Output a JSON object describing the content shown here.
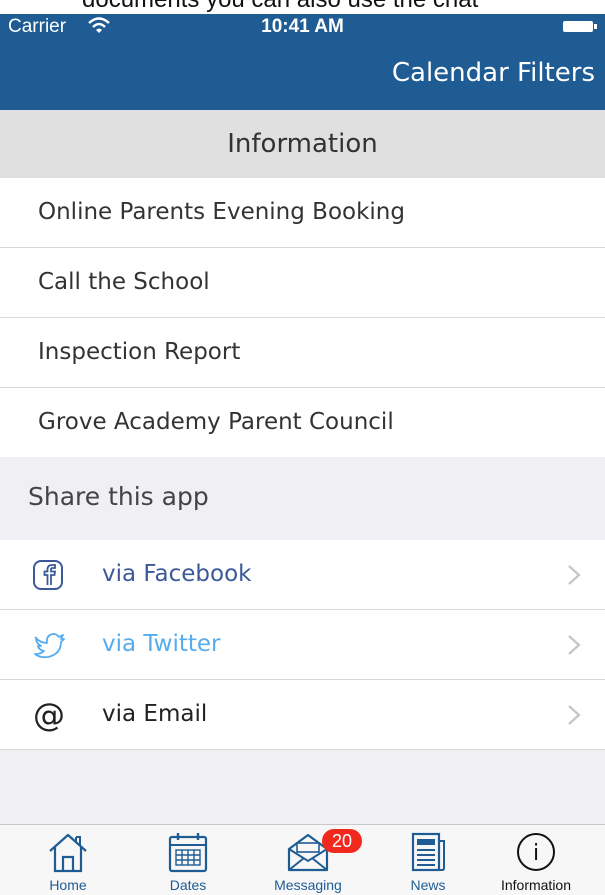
{
  "background_text": "documents you can also use the chat",
  "status_bar": {
    "carrier": "Carrier",
    "time": "10:41 AM"
  },
  "nav": {
    "right_button": "Calendar Filters"
  },
  "information": {
    "header": "Information",
    "items": [
      {
        "label": "Online Parents Evening Booking"
      },
      {
        "label": "Call the School"
      },
      {
        "label": "Inspection Report"
      },
      {
        "label": "Grove Academy Parent Council"
      }
    ]
  },
  "share": {
    "header": "Share this app",
    "items": [
      {
        "label": "via Facebook",
        "icon": "facebook-icon",
        "color": "#3b5998"
      },
      {
        "label": "via Twitter",
        "icon": "twitter-icon",
        "color": "#55acee"
      },
      {
        "label": "via Email",
        "icon": "at-sign-icon",
        "color": "#222222"
      }
    ]
  },
  "tabbar": {
    "tabs": [
      {
        "label": "Home",
        "icon": "home-icon"
      },
      {
        "label": "Dates",
        "icon": "calendar-icon"
      },
      {
        "label": "Messaging",
        "icon": "envelope-icon",
        "badge": "20"
      },
      {
        "label": "News",
        "icon": "newspaper-icon"
      },
      {
        "label": "Information",
        "icon": "info-icon",
        "active": true
      }
    ]
  },
  "colors": {
    "brand": "#1f5c94",
    "badge": "#f0281e",
    "tab_label": "#1f5c94"
  }
}
